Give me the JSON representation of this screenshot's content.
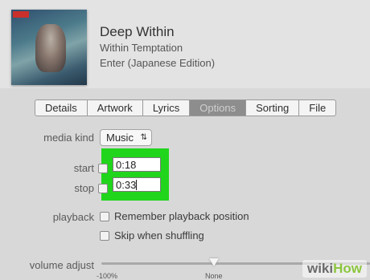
{
  "header": {
    "title": "Deep Within",
    "artist": "Within Temptation",
    "album": "Enter (Japanese Edition)"
  },
  "tabs": [
    {
      "label": "Details",
      "active": false
    },
    {
      "label": "Artwork",
      "active": false
    },
    {
      "label": "Lyrics",
      "active": false
    },
    {
      "label": "Options",
      "active": true
    },
    {
      "label": "Sorting",
      "active": false
    },
    {
      "label": "File",
      "active": false
    }
  ],
  "options": {
    "media_kind_label": "media kind",
    "media_kind_value": "Music",
    "start_label": "start",
    "start_value": "0:18",
    "stop_label": "stop",
    "stop_value": "0:33",
    "playback_label": "playback",
    "remember_label": "Remember playback position",
    "skip_label": "Skip when shuffling",
    "volume_label": "volume adjust",
    "volume_min_label": "-100%",
    "volume_mid_label": "None",
    "volume_level": 0.4
  },
  "watermark": {
    "part1": "wiki",
    "part2": "How"
  },
  "colors": {
    "highlight": "#21d51c",
    "active_tab": "#8d8d8d"
  }
}
